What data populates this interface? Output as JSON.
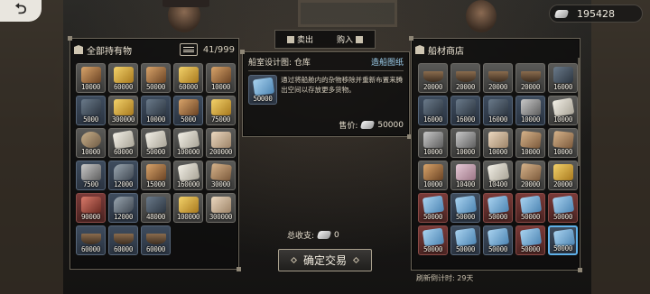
{
  "top_bar": {
    "back_label": "⮌",
    "currency_value": "195428"
  },
  "inventory": {
    "title": "全部持有物",
    "count": "41/999",
    "items": [
      {
        "icon": "brown",
        "qty": "10000",
        "tone": "grey"
      },
      {
        "icon": "gold",
        "qty": "60000",
        "tone": "grey"
      },
      {
        "icon": "brown",
        "qty": "50000",
        "tone": "grey"
      },
      {
        "icon": "gold",
        "qty": "60000",
        "tone": "grey"
      },
      {
        "icon": "brown",
        "qty": "10000",
        "tone": "grey"
      },
      {
        "icon": "dark",
        "qty": "5000",
        "tone": "blue"
      },
      {
        "icon": "gold",
        "qty": "300000",
        "tone": "grey"
      },
      {
        "icon": "dark",
        "qty": "10000",
        "tone": "blue"
      },
      {
        "icon": "brown",
        "qty": "5000",
        "tone": "blue"
      },
      {
        "icon": "gold",
        "qty": "75000",
        "tone": "grey"
      },
      {
        "icon": "anchor",
        "qty": "10000",
        "tone": "grey"
      },
      {
        "icon": "scroll",
        "qty": "60000",
        "tone": "grey"
      },
      {
        "icon": "scroll",
        "qty": "50000",
        "tone": "grey"
      },
      {
        "icon": "scroll",
        "qty": "100000",
        "tone": "grey"
      },
      {
        "icon": "fabric",
        "qty": "200000",
        "tone": "grey"
      },
      {
        "icon": "metal",
        "qty": "7500",
        "tone": "blue"
      },
      {
        "icon": "cannon",
        "qty": "12000",
        "tone": "blue"
      },
      {
        "icon": "brown",
        "qty": "15000",
        "tone": "grey"
      },
      {
        "icon": "scroll",
        "qty": "160000",
        "tone": "grey"
      },
      {
        "icon": "plank",
        "qty": "30000",
        "tone": "grey"
      },
      {
        "icon": "red",
        "qty": "90000",
        "tone": "red"
      },
      {
        "icon": "cannon",
        "qty": "12000",
        "tone": "blue"
      },
      {
        "icon": "dark",
        "qty": "48000",
        "tone": "grey"
      },
      {
        "icon": "gold",
        "qty": "100000",
        "tone": "grey"
      },
      {
        "icon": "fabric",
        "qty": "300000",
        "tone": "grey"
      },
      {
        "icon": "boat",
        "qty": "60000",
        "tone": "blue"
      },
      {
        "icon": "boat",
        "qty": "60000",
        "tone": "blue"
      },
      {
        "icon": "boat",
        "qty": "60000",
        "tone": "blue"
      }
    ]
  },
  "tabs": {
    "sell_label": "卖出",
    "buy_label": "购入"
  },
  "detail": {
    "title": "船室设计图: 仓库",
    "link": "造船图纸",
    "item_qty": "50000",
    "description": "通过将船舱内的杂物移除并重新布置来腾出空间以存放更多货物。",
    "price_label": "售价:",
    "price_value": "50000"
  },
  "summary": {
    "total_label": "总收支:",
    "total_value": "0",
    "confirm_label": "确定交易"
  },
  "shop": {
    "title": "船材商店",
    "refresh": "刷新倒计时: 29天",
    "items": [
      {
        "icon": "boat",
        "qty": "20000",
        "tone": "grey"
      },
      {
        "icon": "boat",
        "qty": "20000",
        "tone": "grey"
      },
      {
        "icon": "boat",
        "qty": "20000",
        "tone": "grey"
      },
      {
        "icon": "boat",
        "qty": "20000",
        "tone": "grey"
      },
      {
        "icon": "dark",
        "qty": "16000",
        "tone": "grey"
      },
      {
        "icon": "dark",
        "qty": "16000",
        "tone": "blue"
      },
      {
        "icon": "dark",
        "qty": "16000",
        "tone": "blue"
      },
      {
        "icon": "dark",
        "qty": "16000",
        "tone": "blue"
      },
      {
        "icon": "metal",
        "qty": "10000",
        "tone": "blue"
      },
      {
        "icon": "scroll",
        "qty": "10000",
        "tone": "grey"
      },
      {
        "icon": "metal",
        "qty": "10000",
        "tone": "grey"
      },
      {
        "icon": "metal",
        "qty": "10000",
        "tone": "grey"
      },
      {
        "icon": "fabric",
        "qty": "10000",
        "tone": "grey"
      },
      {
        "icon": "plank",
        "qty": "10000",
        "tone": "grey"
      },
      {
        "icon": "plank",
        "qty": "10000",
        "tone": "grey"
      },
      {
        "icon": "brown",
        "qty": "10000",
        "tone": "grey"
      },
      {
        "icon": "pink",
        "qty": "10400",
        "tone": "grey"
      },
      {
        "icon": "scroll",
        "qty": "10400",
        "tone": "grey"
      },
      {
        "icon": "plank",
        "qty": "20000",
        "tone": "grey"
      },
      {
        "icon": "gold",
        "qty": "20000",
        "tone": "grey"
      },
      {
        "icon": "blueprint",
        "qty": "50000",
        "tone": "red"
      },
      {
        "icon": "blueprint",
        "qty": "50000",
        "tone": "blue"
      },
      {
        "icon": "blueprint",
        "qty": "50000",
        "tone": "red"
      },
      {
        "icon": "blueprint",
        "qty": "50000",
        "tone": "red"
      },
      {
        "icon": "blueprint",
        "qty": "50000",
        "tone": "red"
      },
      {
        "icon": "blueprint",
        "qty": "50000",
        "tone": "red"
      },
      {
        "icon": "blueprint",
        "qty": "50000",
        "tone": "blue"
      },
      {
        "icon": "blueprint",
        "qty": "50000",
        "tone": "blue"
      },
      {
        "icon": "blueprint",
        "qty": "50000",
        "tone": "red"
      },
      {
        "icon": "blueprint",
        "qty": "50000",
        "tone": "blue",
        "selected": true
      }
    ]
  }
}
